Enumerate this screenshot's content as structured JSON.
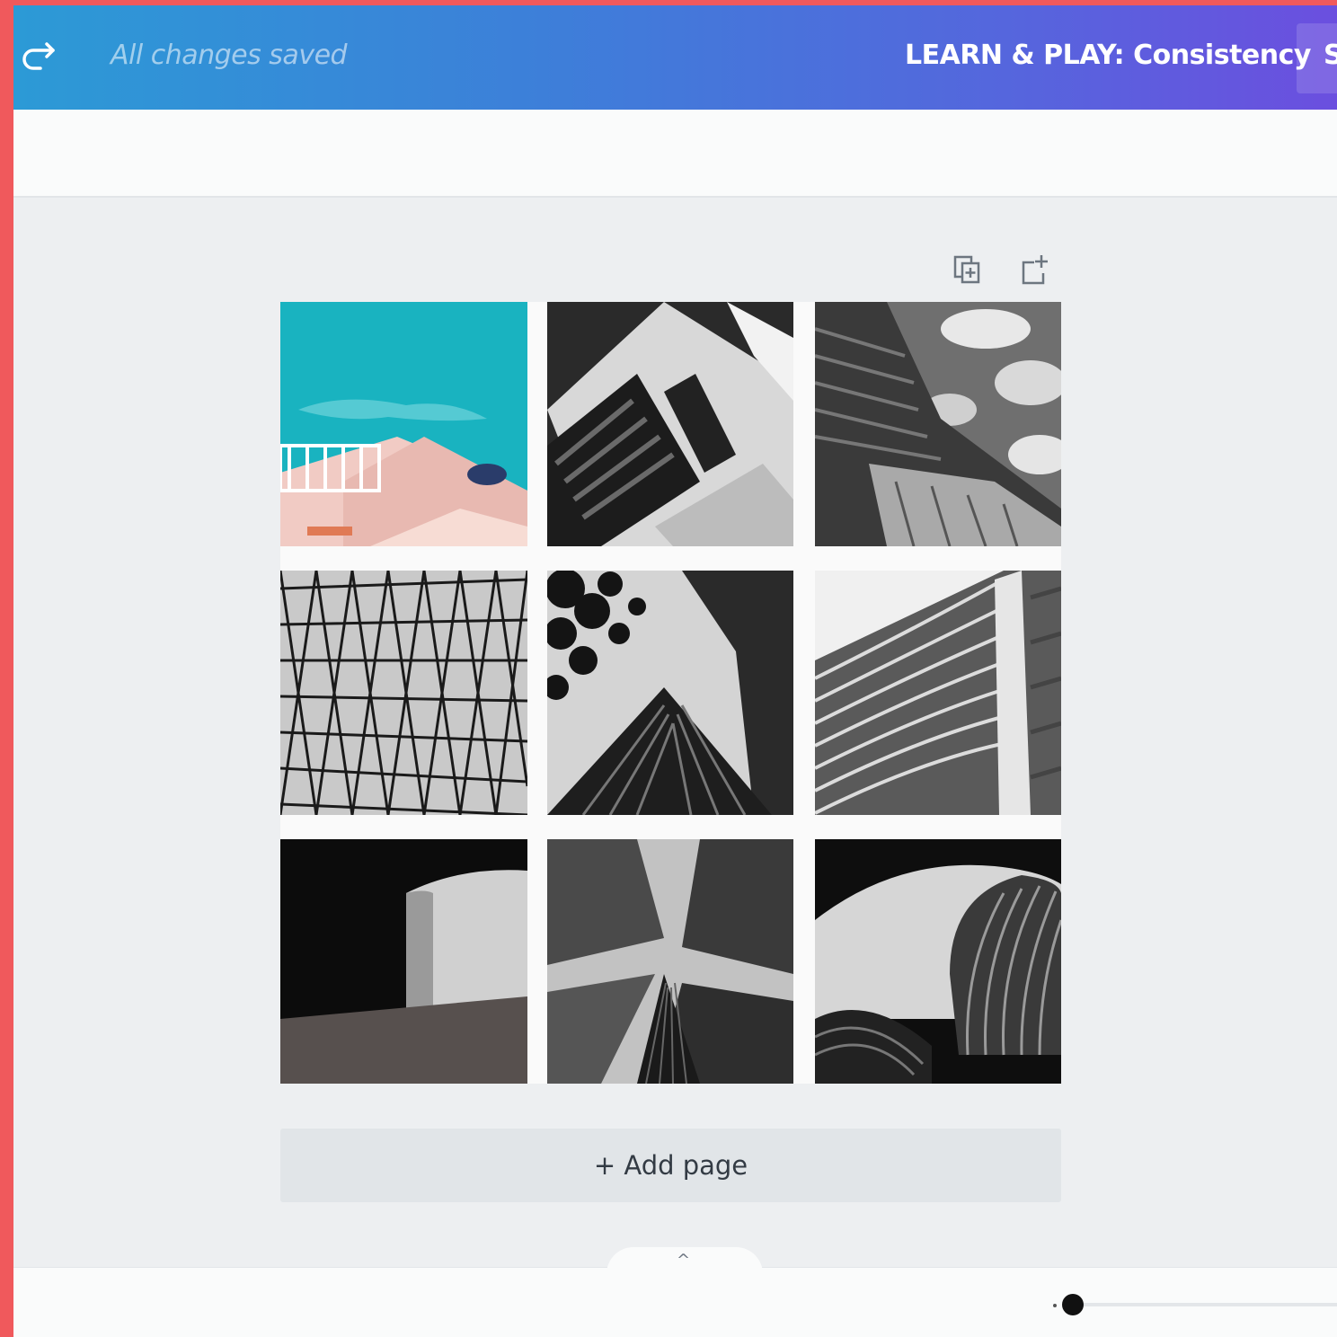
{
  "header": {
    "saved_status": "All changes saved",
    "document_title": "LEARN & PLAY: Consistency",
    "share_label": "S"
  },
  "page_actions": {
    "duplicate_icon": "duplicate-page-icon",
    "add_icon": "add-page-icon"
  },
  "grid": {
    "tiles": [
      {
        "name": "pink-building-teal-sky"
      },
      {
        "name": "bw-angled-facade"
      },
      {
        "name": "bw-glass-tower-clouds"
      },
      {
        "name": "bw-lattice-dome"
      },
      {
        "name": "bw-tower-and-tree"
      },
      {
        "name": "bw-curved-skyscraper"
      },
      {
        "name": "bw-curved-wall-dark"
      },
      {
        "name": "bw-converging-towers"
      },
      {
        "name": "bw-round-tower-arch"
      }
    ]
  },
  "add_page_label": "+ Add page",
  "footer": {
    "collapse_label": "^",
    "zoom_level_fraction": 0.05
  },
  "colors": {
    "frame": "#f0595c",
    "header_start": "#2c9ad6",
    "header_end": "#6b4fdf",
    "canvas_bg": "#edeff1"
  }
}
